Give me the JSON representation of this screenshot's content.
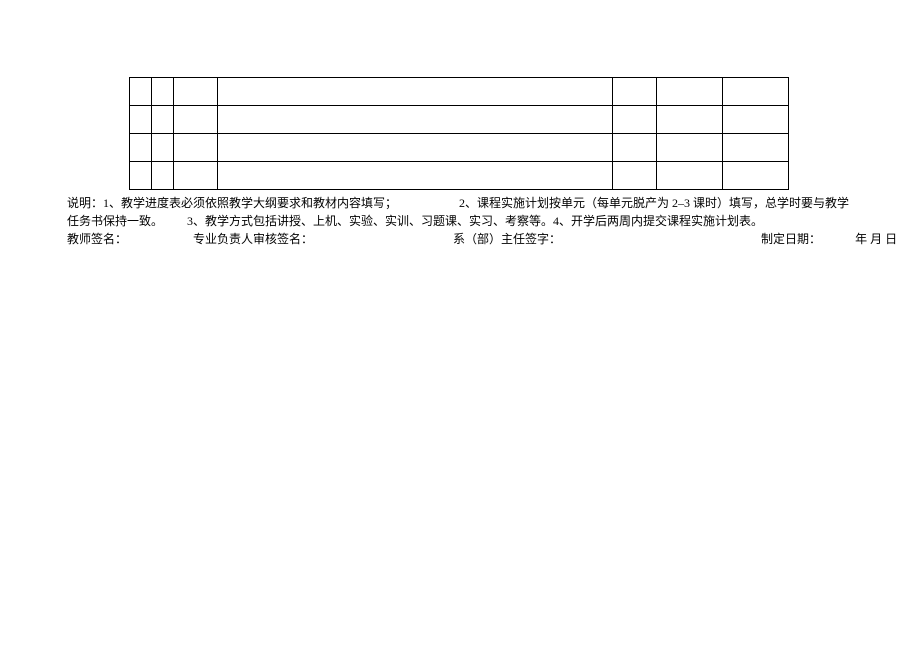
{
  "notes": {
    "prefix": "说明：",
    "item1": "1、教学进度表必须依照教学大纲要求和教材内容填写；",
    "item2": "2、课程实施计划按单元（每单元脱产为 2–3 课时）填写，总学时要与教学任务书保持一致。",
    "item3": "3、教学方式包括讲授、上机、实验、实训、习题课、实习、考察等。",
    "item4": "4、开学后两周内提交课程实施计划表。"
  },
  "signatures": {
    "teacher": "教师签名：",
    "lead": "专业负责人审核签名：",
    "dept_head": "系（部）主任签字：",
    "date_label": "制定日期：",
    "date_value": "年 月 日"
  },
  "table": {
    "rows": 4,
    "cols": 7
  }
}
